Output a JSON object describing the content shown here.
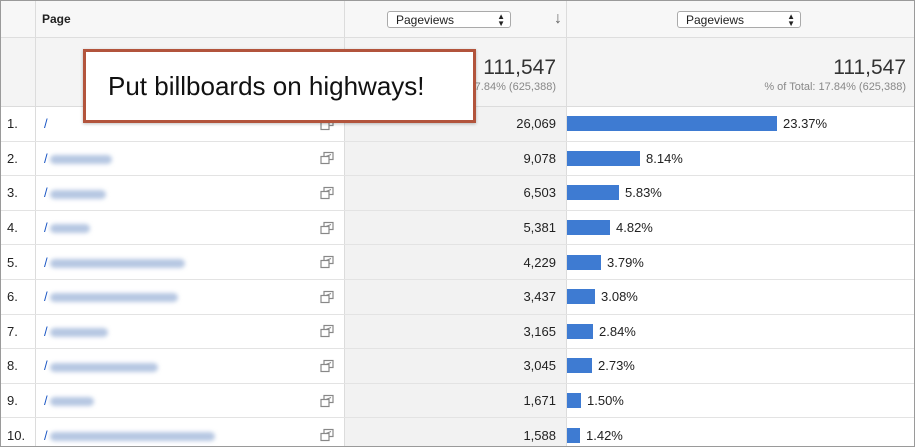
{
  "header": {
    "page_label": "Page",
    "metric_select_1": "Pageviews",
    "metric_select_2": "Pageviews"
  },
  "totals": {
    "col2_value": "111,547",
    "col2_sub": "% of Total: 17.84% (625,388)",
    "col3_value": "111,547",
    "col3_sub": "% of Total: 17.84% (625,388)"
  },
  "callout": "Put billboards on highways!",
  "rows": [
    {
      "num": "1.",
      "path": "/",
      "value": "26,069",
      "pct": "23.37%",
      "fraction": 0.2337,
      "blur": 0
    },
    {
      "num": "2.",
      "path": "/",
      "value": "9,078",
      "pct": "8.14%",
      "fraction": 0.0814,
      "blur": 62
    },
    {
      "num": "3.",
      "path": "/",
      "value": "6,503",
      "pct": "5.83%",
      "fraction": 0.0583,
      "blur": 56
    },
    {
      "num": "4.",
      "path": "/",
      "value": "5,381",
      "pct": "4.82%",
      "fraction": 0.0482,
      "blur": 40
    },
    {
      "num": "5.",
      "path": "/",
      "value": "4,229",
      "pct": "3.79%",
      "fraction": 0.0379,
      "blur": 135
    },
    {
      "num": "6.",
      "path": "/",
      "value": "3,437",
      "pct": "3.08%",
      "fraction": 0.0308,
      "blur": 128
    },
    {
      "num": "7.",
      "path": "/",
      "value": "3,165",
      "pct": "2.84%",
      "fraction": 0.0284,
      "blur": 58
    },
    {
      "num": "8.",
      "path": "/",
      "value": "3,045",
      "pct": "2.73%",
      "fraction": 0.0273,
      "blur": 108
    },
    {
      "num": "9.",
      "path": "/",
      "value": "1,671",
      "pct": "1.50%",
      "fraction": 0.015,
      "blur": 44
    },
    {
      "num": "10.",
      "path": "/",
      "value": "1,588",
      "pct": "1.42%",
      "fraction": 0.0142,
      "blur": 165
    }
  ],
  "colors": {
    "bar": "#3e7bd2",
    "link": "#1a56c4",
    "callout_border": "#b2543c"
  }
}
